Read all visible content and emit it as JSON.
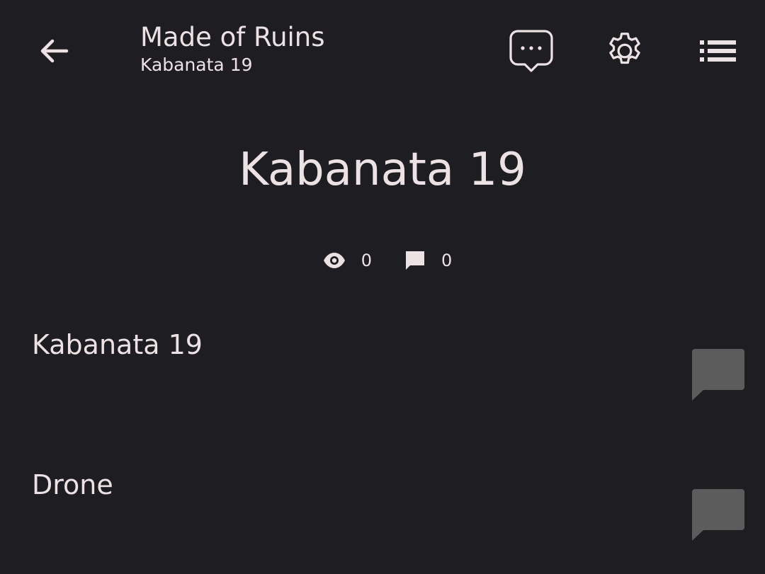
{
  "app_bar": {
    "title": "Made of Ruins",
    "subtitle": "Kabanata 19",
    "icons": {
      "back": "arrow-back-icon",
      "comments": "chat-bubble-dots-icon",
      "settings": "gear-icon",
      "chapters": "list-icon"
    }
  },
  "chapter": {
    "title": "Kabanata 19",
    "views": "0",
    "comments": "0"
  },
  "paragraphs": [
    {
      "text": "Kabanata 19"
    },
    {
      "text": "Drone"
    }
  ],
  "colors": {
    "background": "#1e1d21",
    "text": "#ece2e4",
    "comment_badge": "#5c5c5c"
  }
}
